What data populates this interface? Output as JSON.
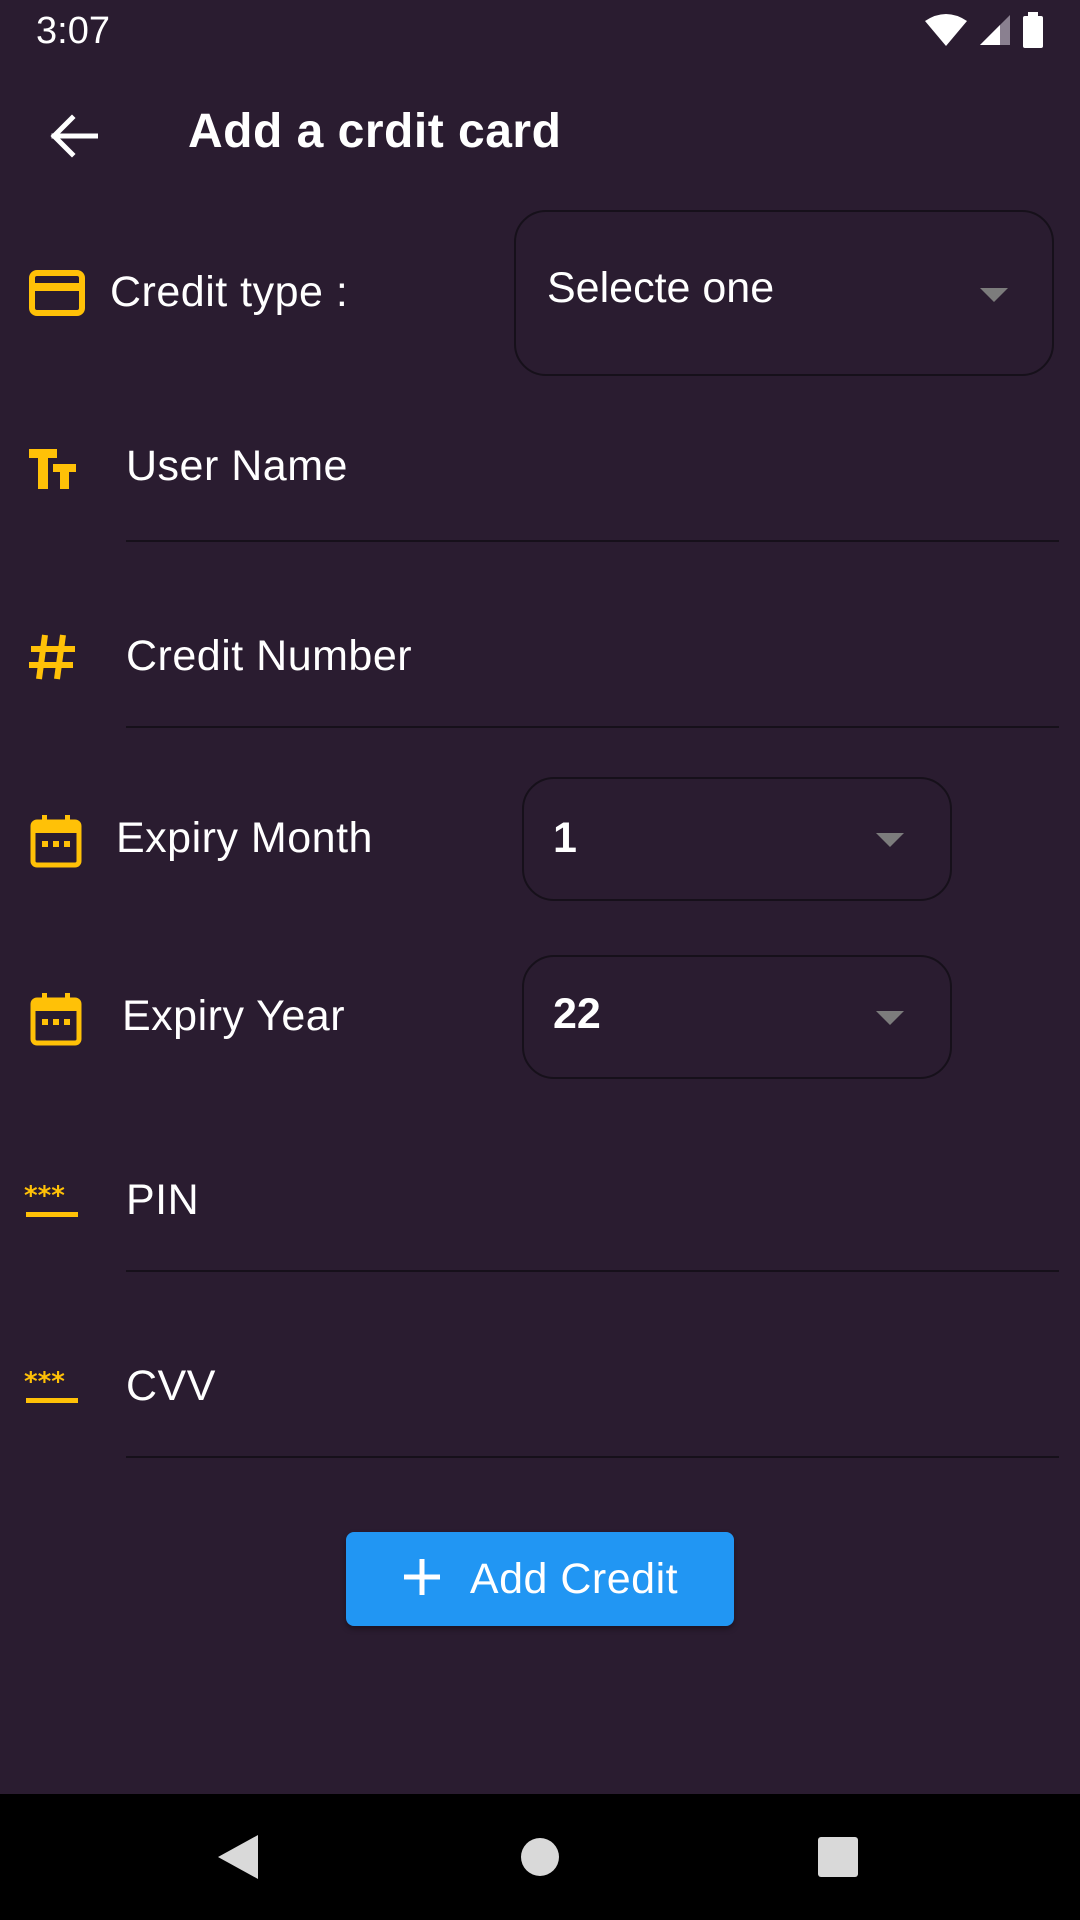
{
  "status_bar": {
    "time": "3:07",
    "icons": [
      "wifi-icon",
      "cell-signal-icon",
      "battery-icon"
    ]
  },
  "app_bar": {
    "title": "Add a crdit card",
    "back_icon": "arrow-back-icon"
  },
  "form": {
    "credit_type": {
      "label": "Credit type :",
      "value": "Selecte one",
      "icon": "credit-card-icon"
    },
    "user_name": {
      "placeholder": "User Name",
      "icon": "text-fields-icon"
    },
    "credit_number": {
      "placeholder": "Credit Number",
      "icon": "hash-icon"
    },
    "expiry_month": {
      "label": "Expiry Month",
      "value": "1",
      "icon": "calendar-icon"
    },
    "expiry_year": {
      "label": "Expiry Year",
      "value": "22",
      "icon": "calendar-icon"
    },
    "pin": {
      "placeholder": "PIN",
      "icon": "password-icon"
    },
    "cvv": {
      "placeholder": "CVV",
      "icon": "password-icon"
    }
  },
  "add_button": {
    "label": "Add Credit",
    "icon": "plus-icon"
  },
  "nav_bar": {
    "items": [
      "back-nav-icon",
      "home-nav-icon",
      "recents-nav-icon"
    ]
  },
  "colors": {
    "background": "#2a1c30",
    "accent_icon": "#ffc107",
    "button": "#2196f3",
    "outline": "#16101a"
  }
}
